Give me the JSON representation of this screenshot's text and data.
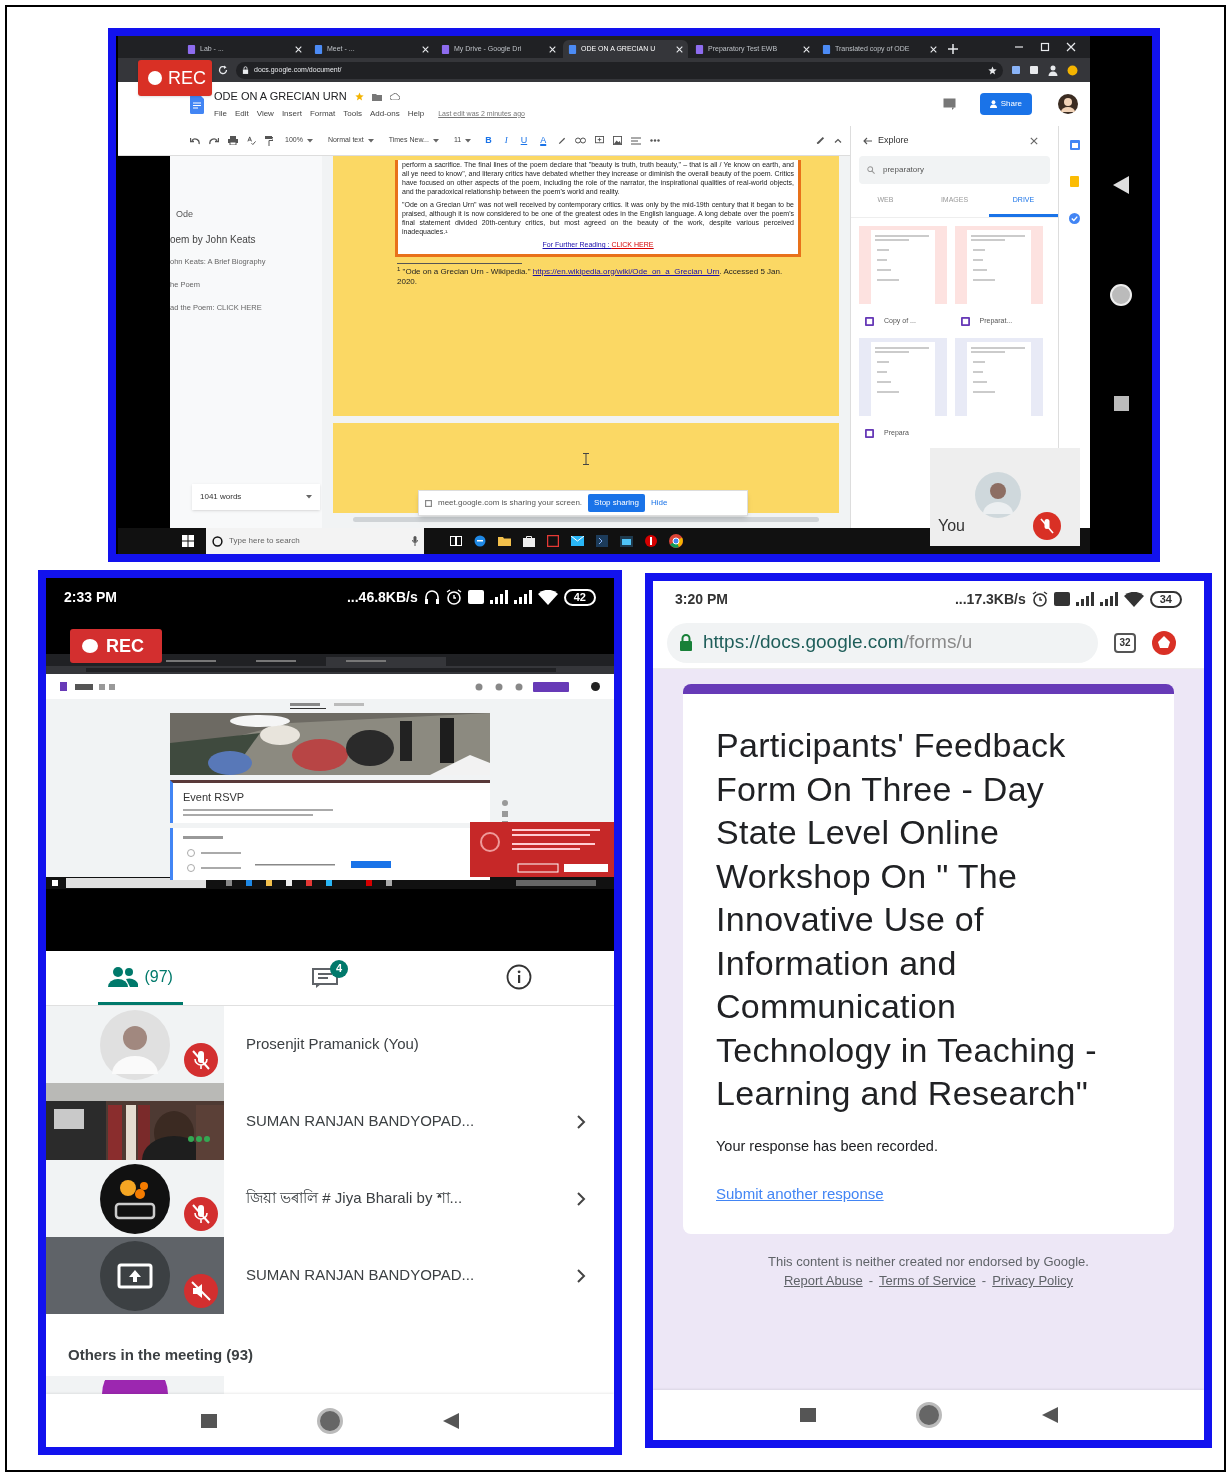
{
  "desktop_recording": {
    "rec_badge": "REC",
    "browser_tabs": [
      {
        "label": "Lab - ...",
        "selected": false
      },
      {
        "label": "Meet - ...",
        "selected": false
      },
      {
        "label": "My Drive - Google Dri",
        "selected": false
      },
      {
        "label": "ODE ON A GRECIAN U",
        "selected": true
      },
      {
        "label": "Preparatory Test EWB",
        "selected": false
      },
      {
        "label": "Translated copy of ODE",
        "selected": false
      }
    ],
    "address": "docs.google.com/document/",
    "document": {
      "title": "ODE ON A GRECIAN URN",
      "menus": [
        "File",
        "Edit",
        "View",
        "Insert",
        "Format",
        "Tools",
        "Add-ons",
        "Help"
      ],
      "last_edit": "Last edit was 2 minutes ago",
      "share": "Share",
      "toolbar": {
        "zoom": "100%",
        "style": "Normal text",
        "font": "Times New...",
        "size": "11",
        "format_buttons": [
          "B",
          "I",
          "U",
          "A"
        ]
      },
      "outline": [
        "Ode",
        "oem by John Keats",
        "ohn Keats: A Brief Biography",
        "he Poem",
        "ad the Poem: CLICK HERE"
      ],
      "paragraphs": [
        "perform a sacrifice. The final lines of the poem declare that \"beauty is truth, truth beauty,\" – that is all / Ye know on earth, and all ye need to know\", and literary critics have debated whether they increase or diminish the overall beauty of the poem. Critics have focused on other aspects of the poem, including the role of the narrator, the inspirational qualities of real-world objects, and the paradoxical relationship between the poem's world and reality.",
        "\"Ode on a Grecian Urn\" was not well received by contemporary critics. It was only by the mid-19th century that it began to be praised, although it is now considered to be one of the greatest odes in the English language. A long debate over the poem's final statement divided 20th-century critics, but most agreed on the beauty of the work, despite various perceived inadequacies.¹"
      ],
      "further_reading": {
        "label": "For Further Reading :",
        "link": "CLICK HERE"
      },
      "footnote": {
        "mark": "1",
        "source": "\"Ode on a Grecian Urn - Wikipedia.\"",
        "url": "https://en.wikipedia.org/wiki/Ode_on_a_Grecian_Urn",
        "accessed": ". Accessed 5 Jan. 2020."
      },
      "word_count": "1041 words"
    },
    "explore": {
      "title": "Explore",
      "query": "preparatory",
      "tabs": [
        {
          "label": "WEB",
          "selected": false
        },
        {
          "label": "IMAGES",
          "selected": false
        },
        {
          "label": "DRIVE",
          "selected": true
        }
      ],
      "results": [
        "Copy of ...",
        "Preparat...",
        "Prepara"
      ]
    },
    "share_bar": {
      "message": "meet.google.com is sharing your screen.",
      "stop": "Stop sharing",
      "hide": "Hide"
    },
    "self_tile": {
      "label": "You",
      "muted": true
    },
    "taskbar": {
      "search_placeholder": "Type here to search"
    }
  },
  "meet_phone": {
    "status": {
      "time": "2:33 PM",
      "speed": "...46.8KB/s",
      "battery": "42"
    },
    "rec_badge": "REC",
    "shared_screen": {
      "form_title": "Event RSVP"
    },
    "tabs": [
      {
        "kind": "people",
        "label": "(97)",
        "selected": true
      },
      {
        "kind": "chat",
        "badge": "4",
        "selected": false
      },
      {
        "kind": "info",
        "selected": false
      }
    ],
    "participants": [
      {
        "name": "Prosenjit Pramanick (You)",
        "kind": "avatar",
        "muted": true,
        "expandable": false
      },
      {
        "name": "SUMAN RANJAN BANDYOPAD...",
        "kind": "camera",
        "muted": false,
        "expandable": true
      },
      {
        "name": "জিয়া ভৰালি # Jiya Bharali by শা...",
        "kind": "logo",
        "muted": true,
        "expandable": true
      },
      {
        "name": "SUMAN RANJAN BANDYOPAD...",
        "kind": "presenting",
        "muted": true,
        "expandable": true
      }
    ],
    "others_heading": "Others in the meeting (93)"
  },
  "forms_phone": {
    "status": {
      "time": "3:20 PM",
      "speed": "...17.3KB/s",
      "battery": "34"
    },
    "url": {
      "host": "https://docs.google.com",
      "path": "/forms/u"
    },
    "tab_count": "32",
    "form": {
      "title": "Participants' Feedback Form On Three - Day State Level Online Workshop On \" The Innovative Use of Information and Communication Technology in Teaching - Learning and Research\"",
      "confirmation": "Your response has been recorded.",
      "link": "Submit another response"
    },
    "footer": {
      "disclaimer": "This content is neither created nor endorsed by Google.",
      "links": [
        "Report Abuse",
        "Terms of Service",
        "Privacy Policy"
      ],
      "separator": "-"
    }
  }
}
